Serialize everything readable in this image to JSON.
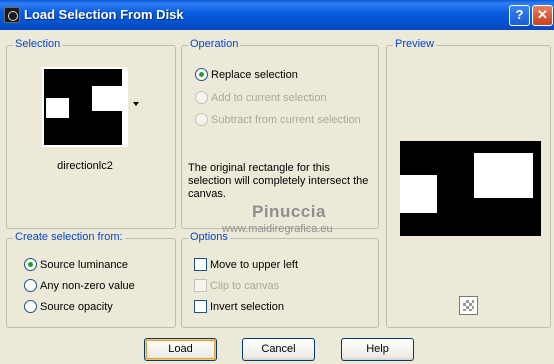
{
  "window": {
    "title": "Load Selection From Disk",
    "help_glyph": "?",
    "close_glyph": "✕"
  },
  "selection": {
    "label": "Selection",
    "name": "directionlc2"
  },
  "operation": {
    "label": "Operation",
    "options": [
      {
        "label": "Replace selection",
        "checked": true,
        "enabled": true
      },
      {
        "label": "Add to current selection",
        "checked": false,
        "enabled": false
      },
      {
        "label": "Subtract from current selection",
        "checked": false,
        "enabled": false
      }
    ],
    "description": "The original rectangle for this selection will completely intersect the canvas."
  },
  "preview": {
    "label": "Preview"
  },
  "create_from": {
    "label": "Create selection from:",
    "options": [
      {
        "label": "Source luminance",
        "checked": true
      },
      {
        "label": "Any non-zero value",
        "checked": false
      },
      {
        "label": "Source opacity",
        "checked": false
      }
    ]
  },
  "options": {
    "label": "Options",
    "items": [
      {
        "label": "Move to upper left",
        "checked": false,
        "enabled": true
      },
      {
        "label": "Clip to canvas",
        "checked": false,
        "enabled": false
      },
      {
        "label": "Invert selection",
        "checked": false,
        "enabled": true
      }
    ]
  },
  "watermark": {
    "line1": "Pinuccia",
    "line2": "www.maidiregrafica.eu"
  },
  "buttons": {
    "load": "Load",
    "cancel": "Cancel",
    "help": "Help"
  }
}
